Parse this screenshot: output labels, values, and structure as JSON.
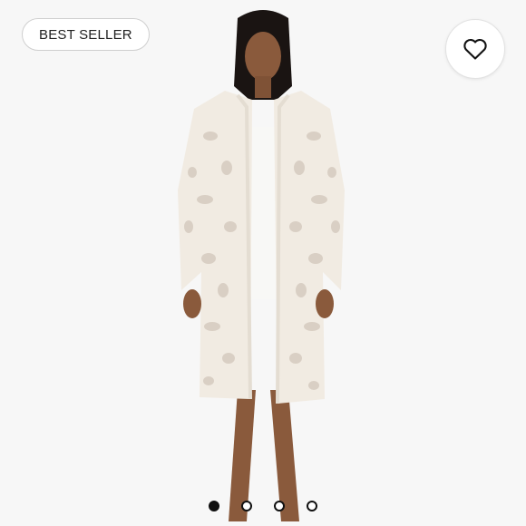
{
  "badge": {
    "label": "BEST SELLER"
  },
  "favorite": {
    "icon": "heart-icon"
  },
  "carousel": {
    "total": 4,
    "active_index": 0
  },
  "colors": {
    "background": "#f7f7f7",
    "robe": "#f1ebe2",
    "leopard_spots": "#d9cfc4",
    "skin": "#8a5a3c"
  }
}
